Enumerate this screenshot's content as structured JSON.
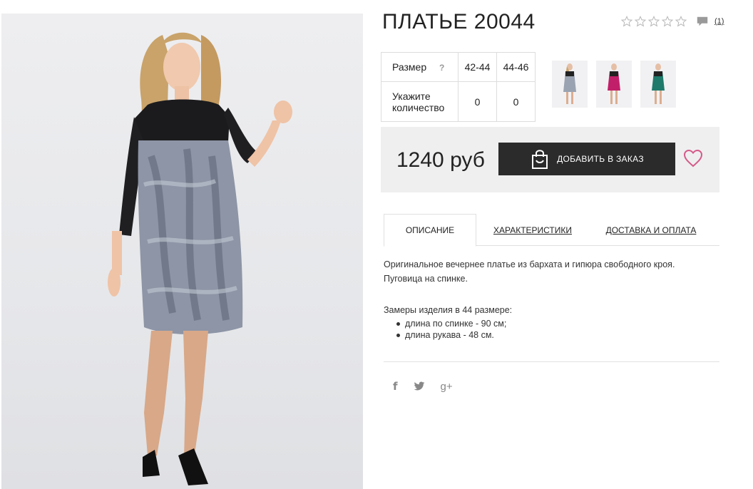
{
  "product": {
    "title": "ПЛАТЬЕ 20044",
    "review_count": "(1)",
    "rating_icons": [
      "star-empty-icon",
      "star-empty-icon",
      "star-empty-icon",
      "star-empty-icon",
      "star-empty-icon"
    ]
  },
  "size_table": {
    "size_label": "Размер",
    "help_mark": "?",
    "sizes": [
      "42-44",
      "44-46"
    ],
    "quantity_label": "Укажите количество",
    "quantities": [
      "0",
      "0"
    ]
  },
  "thumbnails": [
    {
      "name": "thumbnail-gray",
      "color": "#9aa3b1"
    },
    {
      "name": "thumbnail-pink",
      "color": "#c21f6a"
    },
    {
      "name": "thumbnail-green",
      "color": "#1e7a6b"
    }
  ],
  "purchase": {
    "price": "1240 руб",
    "add_button_label": "ДОБАВИТЬ В ЗАКАЗ",
    "accent_color": "#d45b88"
  },
  "tabs": [
    {
      "label": "ОПИСАНИЕ",
      "active": true
    },
    {
      "label": "ХАРАКТЕРИСТИКИ",
      "active": false
    },
    {
      "label": "ДОСТАВКА И ОПЛАТА",
      "active": false
    }
  ],
  "description": {
    "paragraph1_line1": "Оригинальное вечернее платье из бархата и гипюра свободного кроя.",
    "paragraph1_line2": "Пуговица на спинке.",
    "measurements_title": "Замеры изделия в 44 размере:",
    "measurements": [
      "длина по спинке - 90 см;",
      "длина рукава - 48 см."
    ]
  },
  "social": {
    "facebook": "f",
    "twitter": "🐦",
    "google_plus": "g+"
  }
}
